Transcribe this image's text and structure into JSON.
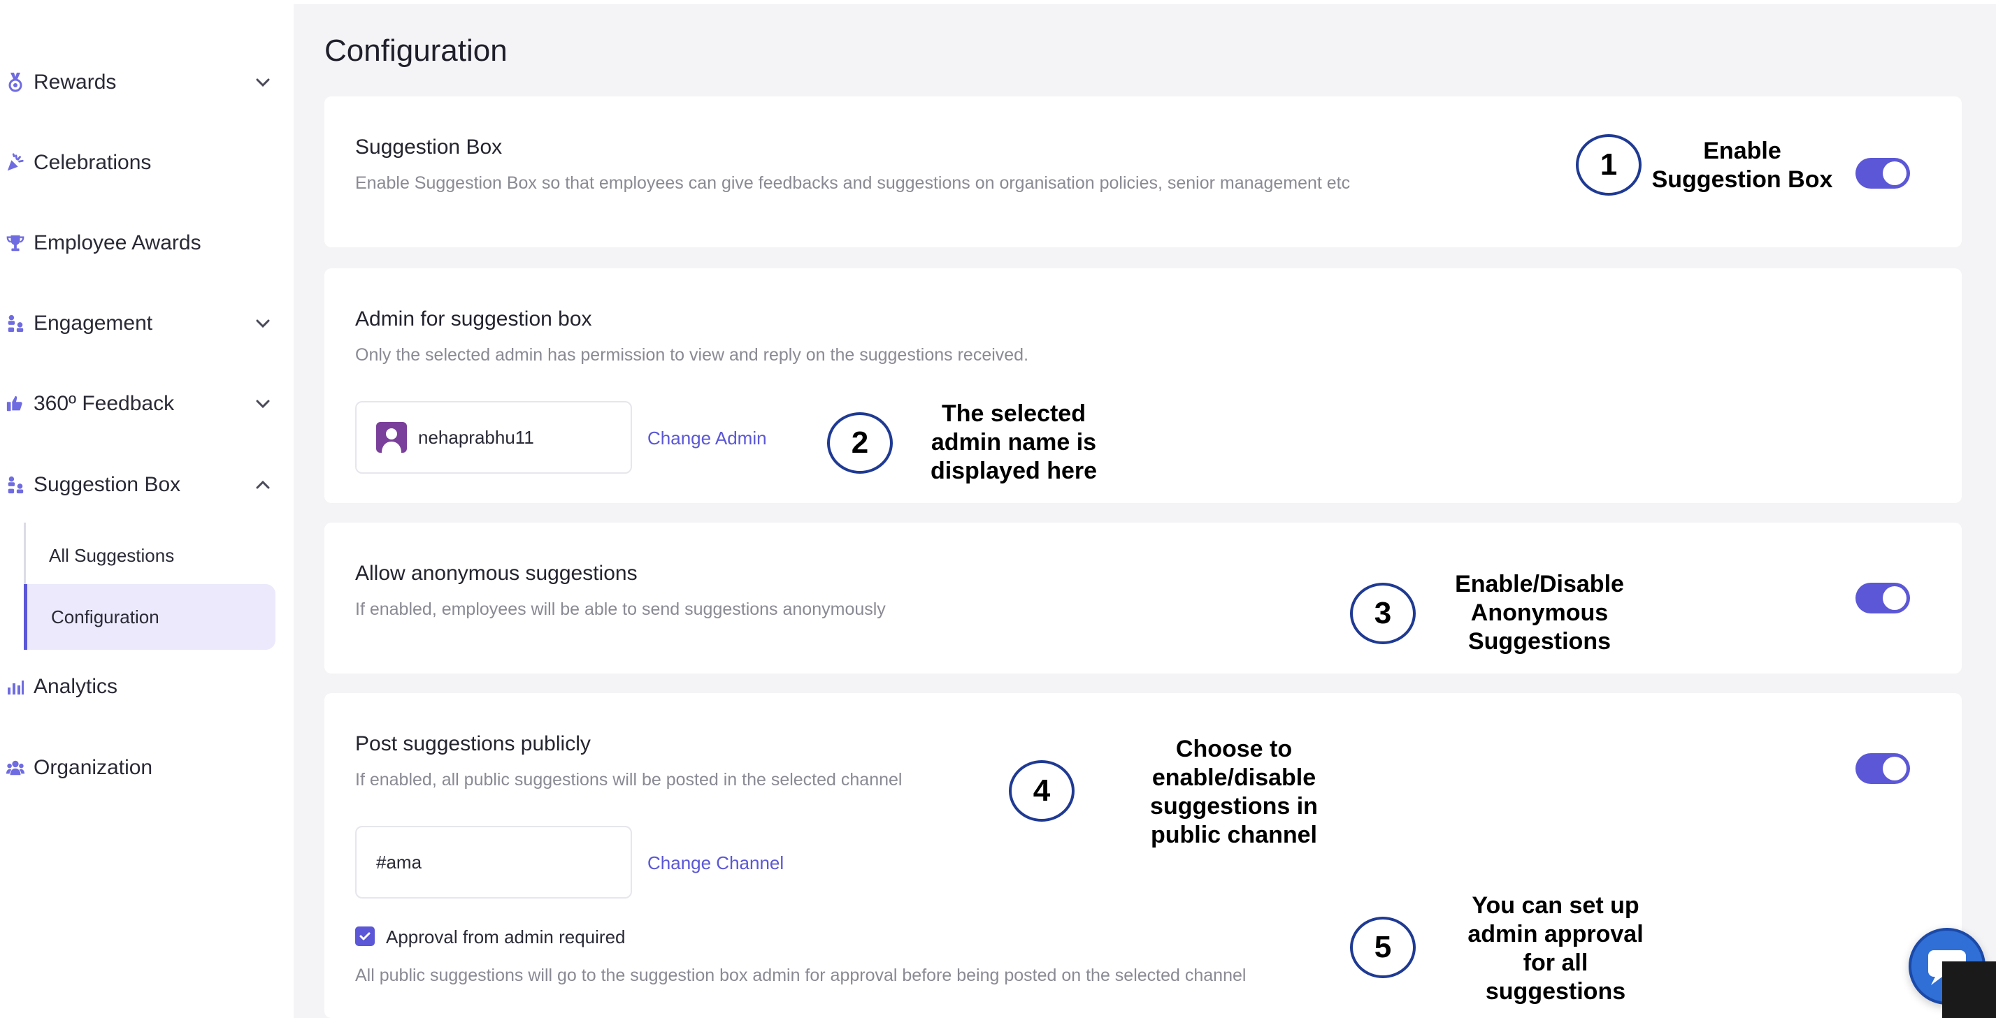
{
  "sidebar": {
    "items": [
      {
        "label": "Rewards",
        "icon": "medal-icon",
        "chevron": "down"
      },
      {
        "label": "Celebrations",
        "icon": "party-popper-icon",
        "chevron": null
      },
      {
        "label": "Employee Awards",
        "icon": "trophy-icon",
        "chevron": null
      },
      {
        "label": "Engagement",
        "icon": "people-hierarchy-icon",
        "chevron": "down"
      },
      {
        "label": "360º Feedback",
        "icon": "feedback-thumbs-icon",
        "chevron": "down"
      },
      {
        "label": "Suggestion Box",
        "icon": "people-hierarchy-icon",
        "chevron": "up"
      },
      {
        "label": "Analytics",
        "icon": "bar-chart-icon",
        "chevron": null
      },
      {
        "label": "Organization",
        "icon": "team-icon",
        "chevron": null
      }
    ],
    "sub_items": [
      {
        "label": "All Suggestions",
        "active": false
      },
      {
        "label": "Configuration",
        "active": true
      }
    ]
  },
  "main": {
    "title": "Configuration",
    "sections": {
      "suggestion_box": {
        "title": "Suggestion Box",
        "description": "Enable Suggestion Box so that employees can give feedbacks and suggestions on organisation policies, senior management etc",
        "enabled": true
      },
      "admin": {
        "title": "Admin for suggestion box",
        "description": "Only the selected admin has permission to view and reply on the suggestions received.",
        "admin_name": "nehaprabhu11",
        "change_label": "Change Admin"
      },
      "anonymous": {
        "title": "Allow anonymous suggestions",
        "description": "If enabled, employees will be able to send suggestions anonymously",
        "enabled": true
      },
      "public": {
        "title": "Post suggestions publicly",
        "description": "If enabled, all public suggestions will be posted in the selected channel",
        "enabled": true,
        "channel": "#ama",
        "change_label": "Change Channel",
        "approval_label": "Approval from admin required",
        "approval_checked": true,
        "approval_description": "All public suggestions will go to the suggestion box admin for approval before being posted on the selected channel"
      }
    }
  },
  "annotations": [
    {
      "number": "1",
      "lines": [
        "Enable",
        "Suggestion Box"
      ]
    },
    {
      "number": "2",
      "lines": [
        "The selected",
        "admin name is",
        "displayed here"
      ]
    },
    {
      "number": "3",
      "lines": [
        "Enable/Disable",
        "Anonymous",
        "Suggestions"
      ]
    },
    {
      "number": "4",
      "lines": [
        "Choose to",
        "enable/disable",
        "suggestions in",
        "public channel"
      ]
    },
    {
      "number": "5",
      "lines": [
        "You can set up",
        "admin approval",
        "for all",
        "suggestions"
      ]
    }
  ],
  "colors": {
    "accent": "#5b57d6",
    "annotation_circle": "#1f3a93",
    "page_bg": "#f4f4f6"
  }
}
